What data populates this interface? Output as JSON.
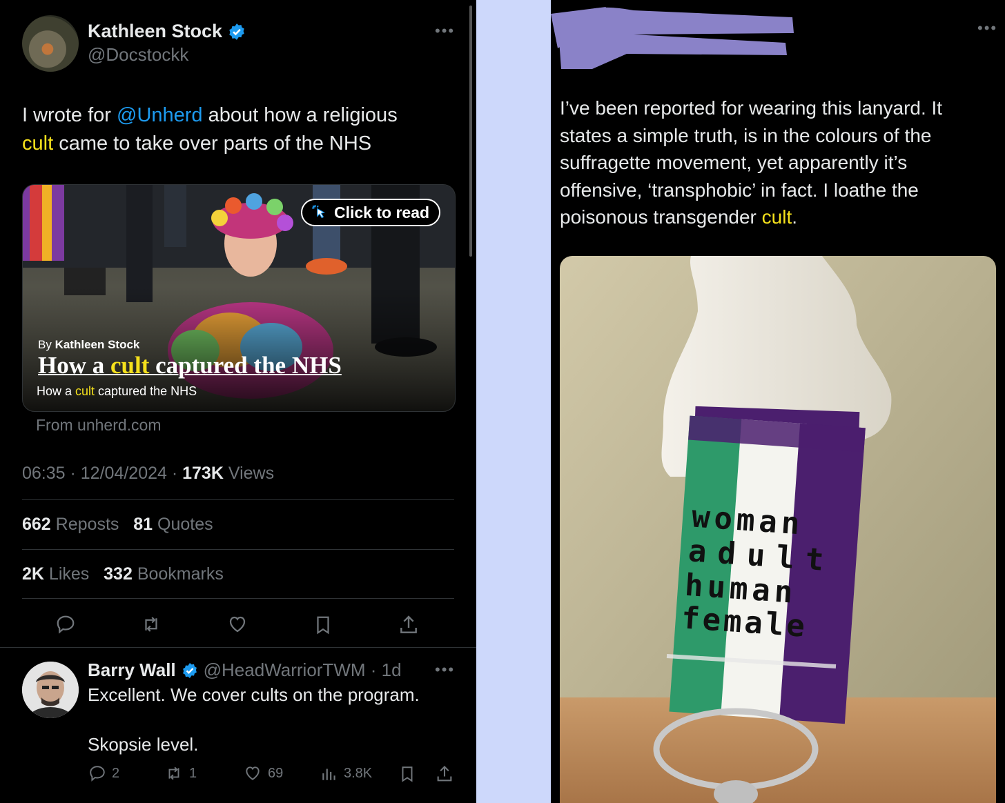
{
  "left": {
    "author": {
      "name": "Kathleen Stock",
      "handle": "@Docstockk"
    },
    "tweet": {
      "text_before": "I wrote for ",
      "mention": "@Unherd",
      "text_mid": " about how a religious",
      "highlight": "cult",
      "text_after": " came to take over parts of the NHS"
    },
    "card": {
      "click_label": "Click to read",
      "byline_prefix": "By ",
      "byline_author": "Kathleen Stock",
      "headline_before": "How a ",
      "headline_highlight": "cult",
      "headline_after": " captured the NHS",
      "subtitle_before": "How a ",
      "subtitle_highlight": "cult",
      "subtitle_after": " captured the NHS",
      "source": "From unherd.com"
    },
    "meta": {
      "time": "06:35",
      "date": "12/04/2024",
      "views_count": "173K",
      "views_label": "Views"
    },
    "stats": {
      "reposts_count": "662",
      "reposts_label": "Reposts",
      "quotes_count": "81",
      "quotes_label": "Quotes",
      "likes_count": "2K",
      "likes_label": "Likes",
      "bookmarks_count": "332",
      "bookmarks_label": "Bookmarks"
    },
    "reply": {
      "name": "Barry Wall",
      "handle": "@HeadWarriorTWM",
      "age": "1d",
      "line1": "Excellent.  We cover cults on the program.",
      "line2": "Skopsie level.",
      "replies": "2",
      "reposts": "1",
      "likes": "69",
      "views": "3.8K"
    }
  },
  "right": {
    "tweet_lines": [
      "I’ve been reported for wearing this lanyard. It",
      "states a simple truth, is in the colours of the",
      "suffragette movement, yet apparently it’s",
      "offensive, ‘transphobic’ in fact. I loathe the"
    ],
    "last_line_before": "poisonous transgender ",
    "last_line_highlight": "cult",
    "last_line_after": ".",
    "lanyard_words": [
      "woman",
      "adult",
      "human",
      "female"
    ]
  },
  "colors": {
    "accent": "#1d9bf0",
    "highlight": "#f5e11c",
    "green": "#2e9a6a",
    "purple": "#4b1f6e",
    "redaction": "#8a82c8"
  }
}
